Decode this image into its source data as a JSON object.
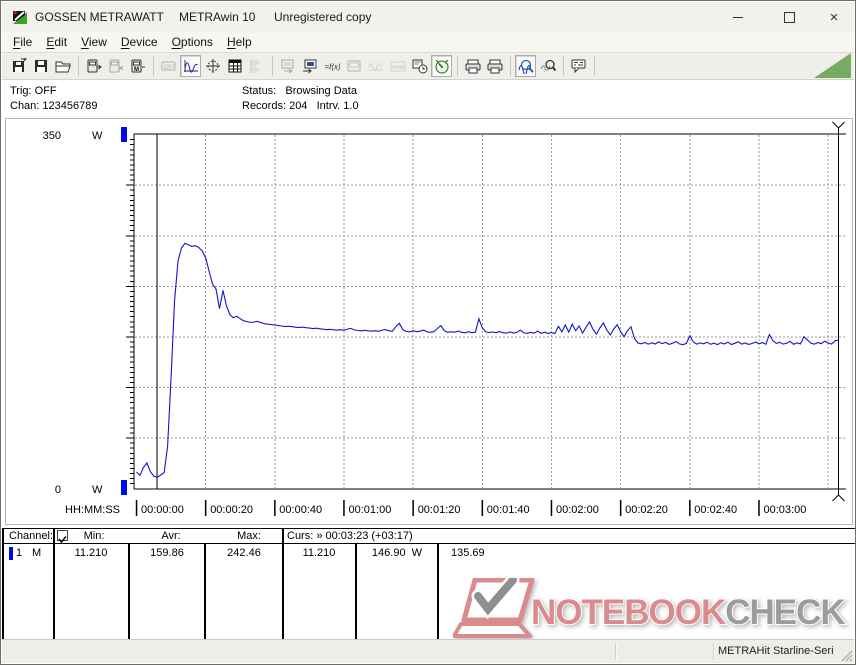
{
  "window": {
    "title_left": "GOSSEN METRAWATT",
    "title_mid": "METRAwin 10",
    "title_right": "Unregistered copy",
    "close_glyph": "×"
  },
  "menu": {
    "items": [
      "File",
      "Edit",
      "View",
      "Device",
      "Options",
      "Help"
    ]
  },
  "toolbar": {
    "buttons": [
      {
        "name": "export-report-button",
        "icon": "floppy_arrow"
      },
      {
        "name": "save-data-button",
        "icon": "floppy"
      },
      {
        "name": "open-file-button",
        "icon": "folder"
      },
      {
        "sep": true
      },
      {
        "name": "device-download-button",
        "icon": "device_arrow"
      },
      {
        "name": "device-disconnect-button",
        "icon": "device_x",
        "state": "disabled"
      },
      {
        "name": "device-memory-button",
        "icon": "device_m"
      },
      {
        "sep": true
      },
      {
        "name": "view-numeric-button",
        "icon": "lcd",
        "state": "disabled"
      },
      {
        "name": "view-curve-button",
        "icon": "wave",
        "state": "pressed"
      },
      {
        "name": "view-cursors-button",
        "icon": "crosshair"
      },
      {
        "name": "view-table-button",
        "icon": "grid"
      },
      {
        "name": "view-histogram-button",
        "icon": "bars",
        "state": "disabled"
      },
      {
        "sep": true
      },
      {
        "name": "export-screen-button",
        "icon": "screen_out",
        "state": "disabled"
      },
      {
        "name": "read-device-button",
        "icon": "screen_in"
      },
      {
        "name": "formula-button",
        "icon": "fx"
      },
      {
        "name": "device-display-button",
        "icon": "lcd2",
        "state": "disabled"
      },
      {
        "name": "analog-signal-button",
        "icon": "wave_gray",
        "state": "disabled"
      },
      {
        "name": "ripple-button",
        "icon": "coil",
        "state": "disabled"
      },
      {
        "name": "timer-settings-button",
        "icon": "clock"
      },
      {
        "name": "live-meter-button",
        "icon": "gauge",
        "state": "pressed"
      },
      {
        "sep": true
      },
      {
        "name": "print-preview-button",
        "icon": "printer"
      },
      {
        "name": "print-button",
        "icon": "printer"
      },
      {
        "sep": true
      },
      {
        "name": "zoom-signal-button",
        "icon": "zoom_wave",
        "state": "pressed"
      },
      {
        "name": "zoom-tool-button",
        "icon": "zoom_lens"
      },
      {
        "sep": true
      },
      {
        "name": "annotation-button",
        "icon": "bubble"
      },
      {
        "sep": true
      }
    ]
  },
  "info": {
    "trig": "Trig: OFF",
    "chan": "Chan: 123456789",
    "status": "Status:   Browsing Data",
    "records": "Records: 204   Intrv. 1.0"
  },
  "chart_data": {
    "type": "line",
    "unit": "W",
    "ylim": [
      0,
      350
    ],
    "y_top_label": "350",
    "y_bottom_label": "0",
    "y_unit_label": "W",
    "x_axis_label": "HH:MM:SS",
    "x_tick_interval_s": 20,
    "x_tick_labels": [
      "00:00:00",
      "00:00:20",
      "00:00:40",
      "00:01:00",
      "00:01:20",
      "00:01:40",
      "00:02:00",
      "00:02:20",
      "00:02:40",
      "00:03:00"
    ],
    "sample_interval_s": 1.0,
    "records": 204,
    "grid": true,
    "cursors": {
      "cursor1_s": 6,
      "cursor2_s": 203,
      "cursor2_time": "00:03:23",
      "delta": "+03:17"
    },
    "stats": {
      "min": 11.21,
      "avg": 159.86,
      "max": 242.46,
      "cursor1_value": 11.21,
      "cursor2_value": 146.9,
      "delta_value": 135.69
    },
    "series": [
      {
        "name": "Channel 1 Power (W)",
        "values": [
          16.5,
          13.2,
          21.0,
          25.5,
          17.0,
          12.3,
          11.21,
          13.5,
          16.0,
          42.0,
          110.0,
          185.0,
          225.0,
          238.0,
          242.46,
          241.0,
          239.5,
          240.2,
          238.5,
          235.0,
          228.0,
          215.0,
          202.0,
          197.5,
          178.0,
          196.0,
          181.0,
          172.0,
          169.0,
          170.5,
          168.0,
          166.0,
          165.2,
          164.3,
          164.8,
          165.5,
          164.2,
          163.1,
          162.6,
          162.2,
          161.8,
          161.2,
          160.8,
          160.2,
          160.6,
          160.1,
          159.6,
          159.2,
          159.7,
          159.1,
          158.7,
          158.2,
          158.6,
          158.1,
          157.7,
          157.2,
          157.6,
          157.1,
          156.8,
          157.2,
          156.6,
          157.8,
          158.4,
          157.0,
          156.4,
          156.0,
          156.6,
          156.1,
          155.7,
          156.2,
          155.6,
          156.8,
          157.3,
          156.1,
          155.6,
          160.2,
          163.5,
          157.2,
          155.5,
          155.1,
          156.2,
          155.2,
          155.7,
          156.8,
          155.1,
          154.6,
          155.2,
          158.3,
          161.2,
          156.2,
          154.6,
          155.1,
          154.7,
          155.8,
          154.6,
          154.1,
          155.2,
          154.2,
          154.7,
          168.0,
          159.0,
          155.0,
          154.3,
          154.9,
          154.2,
          155.4,
          154.1,
          153.8,
          154.9,
          153.9,
          154.5,
          156.8,
          154.0,
          153.6,
          154.6,
          153.7,
          155.9,
          153.5,
          154.8,
          153.4,
          154.4,
          153.3,
          160.5,
          155.0,
          161.8,
          154.8,
          162.6,
          156.2,
          160.9,
          153.8,
          159.7,
          164.9,
          157.6,
          152.8,
          158.9,
          163.8,
          156.9,
          151.9,
          157.8,
          162.2,
          155.3,
          150.2,
          156.4,
          160.0,
          148.5,
          144.0,
          143.2,
          144.5,
          142.8,
          144.2,
          143.0,
          145.1,
          143.4,
          144.6,
          142.6,
          143.8,
          145.4,
          143.1,
          142.3,
          143.6,
          151.2,
          145.0,
          142.9,
          144.1,
          143.2,
          144.8,
          142.7,
          143.9,
          142.4,
          144.3,
          143.0,
          144.9,
          142.5,
          143.7,
          145.2,
          142.9,
          144.0,
          142.6,
          143.5,
          145.0,
          143.2,
          144.4,
          142.8,
          152.3,
          146.5,
          143.6,
          144.7,
          142.9,
          143.8,
          145.6,
          142.7,
          144.2,
          143.1,
          150.1,
          147.2,
          143.9,
          142.8,
          144.5,
          143.3,
          145.8,
          144.0,
          143.0,
          146.2,
          146.9
        ]
      }
    ]
  },
  "table": {
    "header": {
      "channel": "Channel:",
      "min": "Min:",
      "avr": "Avr:",
      "max": "Max:",
      "cursor": "Curs: » 00:03:23 (+03:17)",
      "checkbox_checked": true
    },
    "row": {
      "channel_num": "1",
      "mode": "M",
      "min": "11.210",
      "avr": "159.86",
      "max": "242.46",
      "cursor1": "11.210",
      "cursor2": "146.90  W",
      "delta": "135.69"
    }
  },
  "watermark": {
    "brand_primary": "NOTEBOOK",
    "brand_secondary": "CHECK"
  },
  "statusbar": {
    "device": "METRAHit Starline-Seri"
  },
  "colors": {
    "curve": "#1515cd",
    "grid": "#9a9a9a",
    "channel_marker": "#0009e6",
    "brand_red": "#d98b8d",
    "brand_gray": "#9c9c9c",
    "triangle_green": "#76ab61"
  }
}
